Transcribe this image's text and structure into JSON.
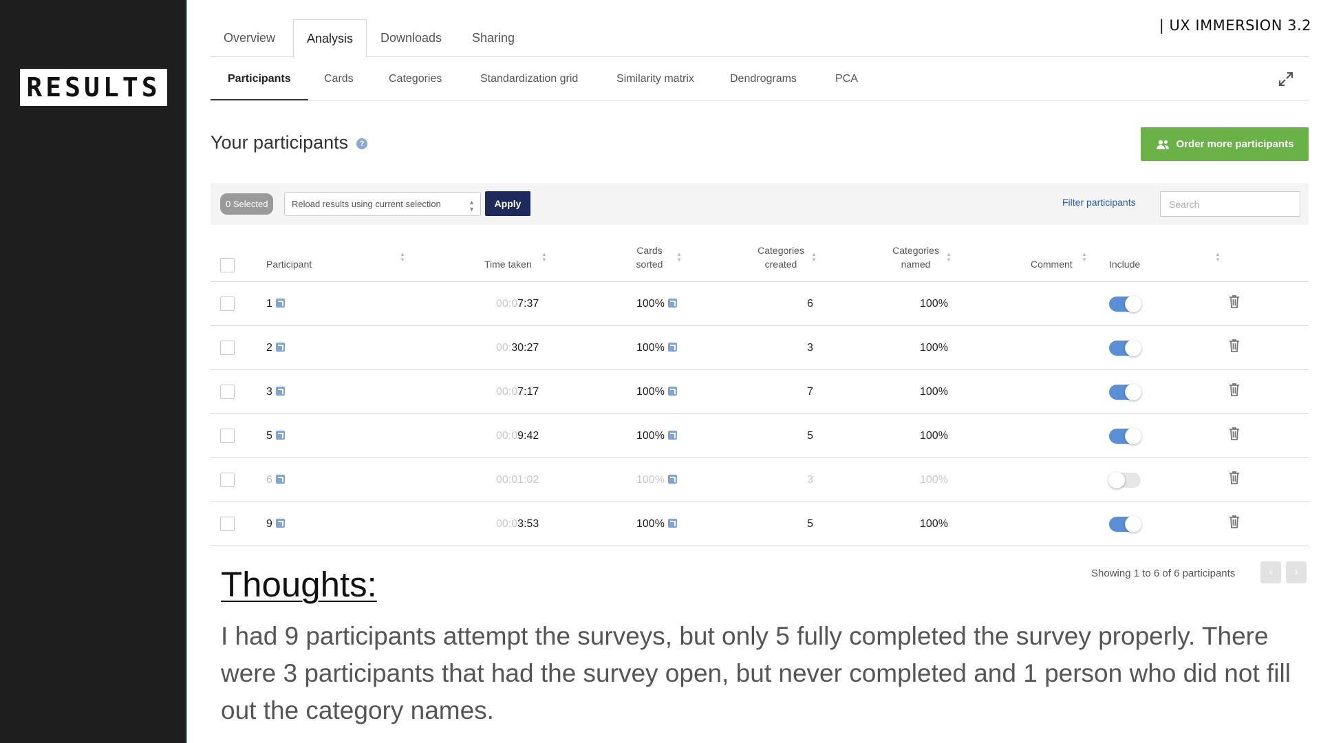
{
  "slide": {
    "label": "RESULTS",
    "deck_title": "|  UX IMMERSION 3.2"
  },
  "top_tabs": [
    {
      "label": "Overview",
      "active": false
    },
    {
      "label": "Analysis",
      "active": true
    },
    {
      "label": "Downloads",
      "active": false
    },
    {
      "label": "Sharing",
      "active": false
    }
  ],
  "sub_tabs": [
    {
      "label": "Participants",
      "active": true
    },
    {
      "label": "Cards",
      "active": false
    },
    {
      "label": "Categories",
      "active": false
    },
    {
      "label": "Standardization grid",
      "active": false
    },
    {
      "label": "Similarity matrix",
      "active": false
    },
    {
      "label": "Dendrograms",
      "active": false
    },
    {
      "label": "PCA",
      "active": false
    }
  ],
  "section": {
    "title": "Your participants",
    "order_button": "Order more participants"
  },
  "toolbar": {
    "selected_count": "0 Selected",
    "reload_option": "Reload results using current selection",
    "apply_label": "Apply",
    "filter_label": "Filter participants",
    "search_placeholder": "Search"
  },
  "columns": {
    "participant": "Participant",
    "time_taken": "Time taken",
    "cards_sorted_1": "Cards",
    "cards_sorted_2": "sorted",
    "categories_created_1": "Categories",
    "categories_created_2": "created",
    "categories_named_1": "Categories",
    "categories_named_2": "named",
    "comment": "Comment",
    "include": "Include"
  },
  "rows": [
    {
      "id": "1",
      "time_prefix": "00:0",
      "time_value": "7:37",
      "cards_sorted": "100%",
      "categories_created": "6",
      "categories_named": "100%",
      "included": true
    },
    {
      "id": "2",
      "time_prefix": "00:",
      "time_value": "30:27",
      "cards_sorted": "100%",
      "categories_created": "3",
      "categories_named": "100%",
      "included": true
    },
    {
      "id": "3",
      "time_prefix": "00:0",
      "time_value": "7:17",
      "cards_sorted": "100%",
      "categories_created": "7",
      "categories_named": "100%",
      "included": true
    },
    {
      "id": "5",
      "time_prefix": "00:0",
      "time_value": "9:42",
      "cards_sorted": "100%",
      "categories_created": "5",
      "categories_named": "100%",
      "included": true
    },
    {
      "id": "6",
      "time_prefix": "",
      "time_value": "00:01:02",
      "cards_sorted": "100%",
      "categories_created": "3",
      "categories_named": "100%",
      "included": false
    },
    {
      "id": "9",
      "time_prefix": "00:0",
      "time_value": "3:53",
      "cards_sorted": "100%",
      "categories_created": "5",
      "categories_named": "100%",
      "included": true
    }
  ],
  "pagination": {
    "summary": "Showing 1 to 6 of 6 participants",
    "prev": "‹",
    "next": "›"
  },
  "thoughts": {
    "title": "Thoughts:",
    "body": "I had 9 participants attempt the surveys, but only 5 fully completed the survey properly. There were 3 participants that had the survey open, but never completed and 1 person who did not fill out the category names."
  },
  "colors": {
    "accent_green": "#6ab248",
    "apply_navy": "#1f2a5c",
    "toggle_blue": "#5a8fd6",
    "rail_dark": "#1e1e1e"
  },
  "icons": [
    "expand-icon",
    "help-icon",
    "users-icon",
    "external-link-icon",
    "trash-icon",
    "sort-icon",
    "chevron-left-icon",
    "chevron-right-icon"
  ]
}
